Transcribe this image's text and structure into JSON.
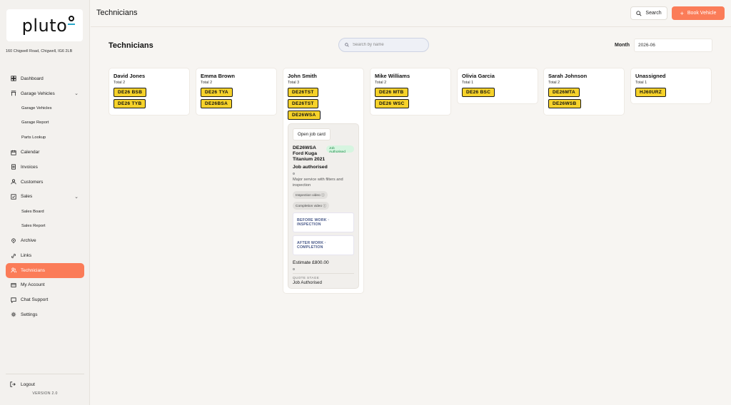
{
  "app": {
    "logo": "pluto",
    "address": "160 Chigwell Road, Chigwell, IG6 2LB",
    "version": "VERSION 2.0"
  },
  "sidebar": {
    "items": [
      {
        "label": "Dashboard",
        "icon": "dashboard-icon",
        "sub": false
      },
      {
        "label": "Garage Vehicles",
        "icon": "garage-icon",
        "sub": false,
        "expandable": true
      },
      {
        "label": "Garage Vehicles",
        "sub": true
      },
      {
        "label": "Garage Report",
        "sub": true
      },
      {
        "label": "Parts Lookup",
        "sub": true
      },
      {
        "label": "Calendar",
        "icon": "calendar-icon",
        "sub": false
      },
      {
        "label": "Invoices",
        "icon": "invoice-icon",
        "sub": false
      },
      {
        "label": "Customers",
        "icon": "user-icon",
        "sub": false
      },
      {
        "label": "Sales",
        "icon": "checkbox-icon",
        "sub": false,
        "expandable": true
      },
      {
        "label": "Sales Board",
        "sub": true
      },
      {
        "label": "Sales Report",
        "sub": true
      },
      {
        "label": "Archive",
        "icon": "pin-icon",
        "sub": false
      },
      {
        "label": "Links",
        "icon": "link-icon",
        "sub": false
      },
      {
        "label": "Technicians",
        "icon": "users-icon",
        "sub": false,
        "active": true
      },
      {
        "label": "My Account",
        "icon": "card-icon",
        "sub": false
      },
      {
        "label": "Chat Support",
        "icon": "chat-icon",
        "sub": false
      },
      {
        "label": "Settings",
        "icon": "settings-icon",
        "sub": false
      }
    ],
    "logout": "Logout"
  },
  "topbar": {
    "title": "Technicians",
    "search_label": "Search",
    "book_label": "Book Vehicle"
  },
  "main": {
    "title": "Technicians",
    "search_placeholder": "Search by name",
    "month_label": "Month",
    "month_value": "2026-06"
  },
  "technicians": [
    {
      "name": "David Jones",
      "total": "Total 2",
      "plates": [
        "DE26 BSB",
        "DE26 TYB"
      ]
    },
    {
      "name": "Emma Brown",
      "total": "Total 2",
      "plates": [
        "DE26 TYA",
        "DE26BSA"
      ]
    },
    {
      "name": "John Smith",
      "total": "Total 3",
      "plates": [
        "DE26TST",
        "DE26TST",
        "DE26WSA"
      ]
    },
    {
      "name": "Mike Williams",
      "total": "Total 2",
      "plates": [
        "DE26 MTB",
        "DE26 WSC"
      ]
    },
    {
      "name": "Olivia Garcia",
      "total": "Total 1",
      "plates": [
        "DE26 BSC"
      ]
    },
    {
      "name": "Sarah Johnson",
      "total": "Total 2",
      "plates": [
        "DE26MTA",
        "DE26WSB"
      ]
    },
    {
      "name": "Unassigned",
      "total": "Total 1",
      "plates": [
        "HJ60URZ"
      ]
    }
  ],
  "job_card": {
    "open_label": "Open job card",
    "vehicle": "DE26WSA Ford Kuga Titanium 2021",
    "badge": "Job Authorised",
    "status": "Job authorised",
    "description": "Major service with filters and inspection",
    "inspection_video": "Inspection video ⓘ",
    "completion_video": "Completion video ⓘ",
    "before_work": "BEFORE WORK · INSPECTION",
    "after_work": "AFTER WORK · COMPLETION",
    "estimate": "Estimate £800.00",
    "quote_stage_label": "QUOTE STAGE",
    "quote_stage_value": "Job Authorised"
  },
  "colors": {
    "accent": "#fb7c58",
    "plate": "#f6d22a",
    "badge_green": "#1e8a48"
  }
}
